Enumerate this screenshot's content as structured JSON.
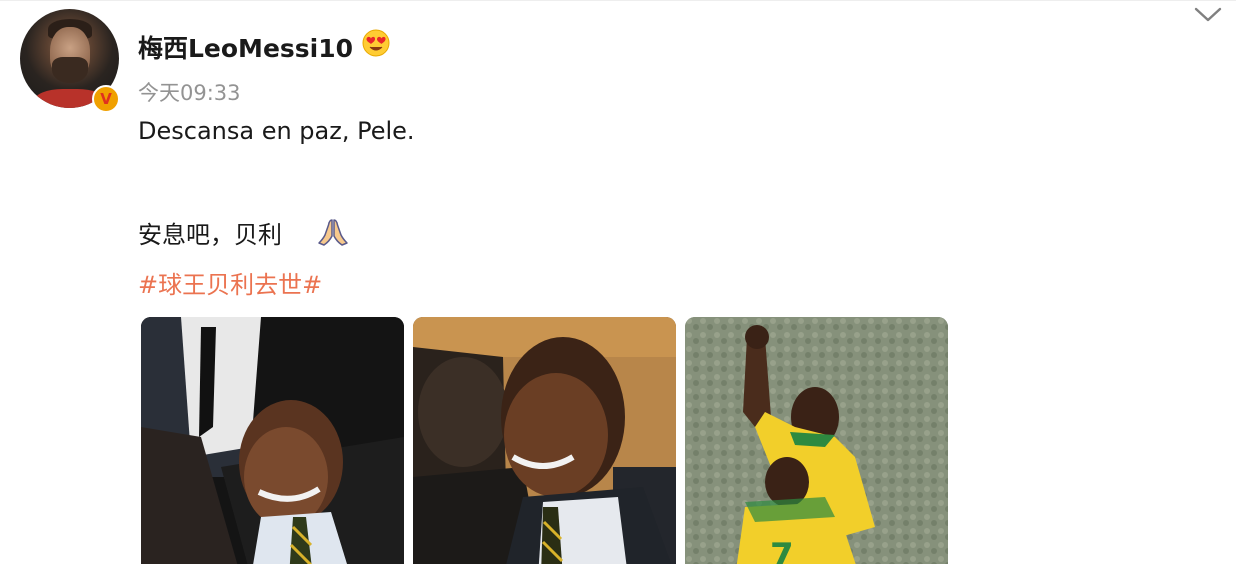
{
  "post": {
    "username": "梅西LeoMessi10",
    "timestamp": "今天09:33",
    "text_line_1": "Descansa en paz, Pele.",
    "text_line_2": "安息吧，贝利",
    "hashtag": "#球王贝利去世#"
  },
  "icons": {
    "avatar": "avatar-messi",
    "verified": "verified-v-badge",
    "user_emoji": "heart-eyes-emoji-icon",
    "menu": "chevron-down-icon",
    "text_emoji": "praying-hands-emoji-icon"
  },
  "badge": {
    "verified_letter": "V"
  },
  "photos": [
    {
      "name": "photo-pele-suit-smiling"
    },
    {
      "name": "photo-pele-embracing"
    },
    {
      "name": "photo-pele-celebrating-brazil-jersey"
    }
  ],
  "colors": {
    "hashtag": "#eb7350",
    "timestamp": "#939393",
    "text": "#1a1a1a",
    "verified_bg": "#f0a000",
    "verified_letter": "#e0301e"
  }
}
